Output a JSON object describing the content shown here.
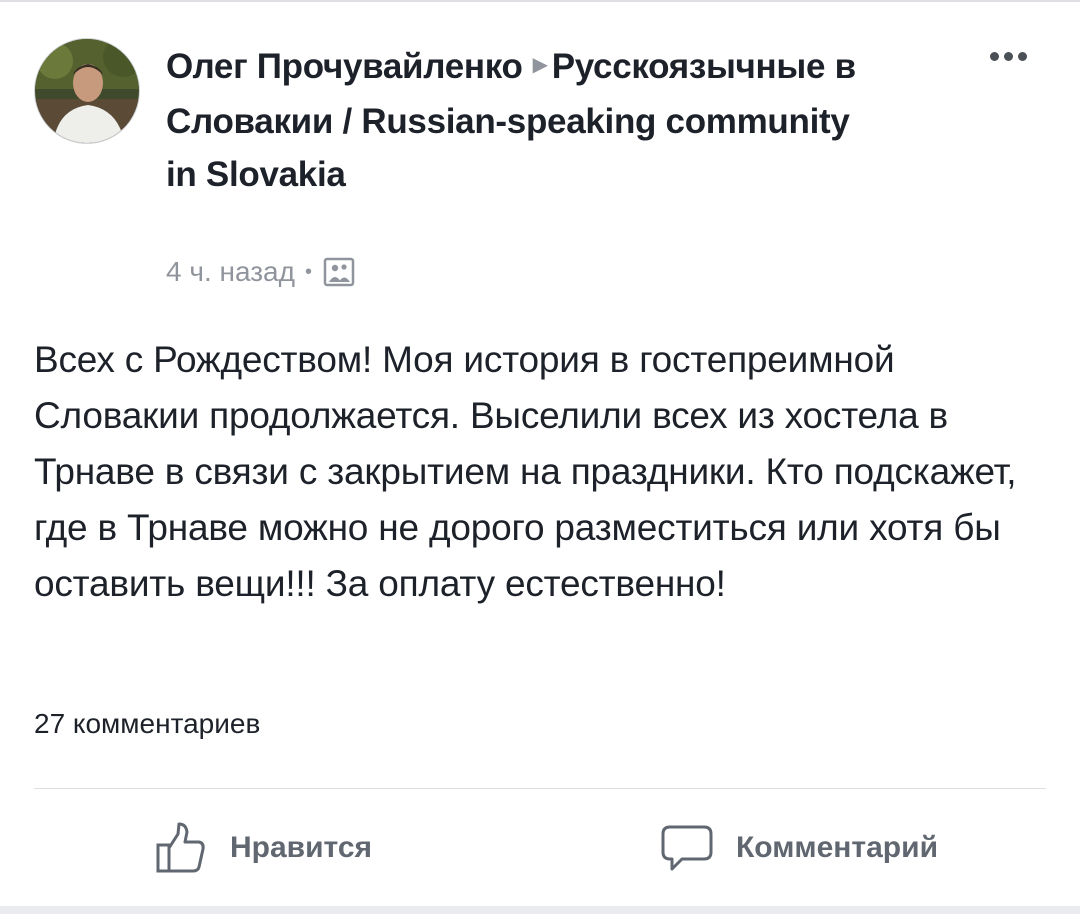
{
  "post": {
    "author": "Олег Прочувайленко",
    "arrow_icon": "triangle-right-icon",
    "group": "Русскоязычные в Словакии / Russian-speaking community in Slovakia",
    "time": "4 ч. назад",
    "separator": "•",
    "audience_icon": "group-photo-icon",
    "more_icon": "three-dots-icon",
    "body": "Всех с Рождеством! Моя история в гостепреимной Словакии продолжается. Выселили всех из хостела в Трнаве в связи с закрытием на праздники. Кто подскажет, где в Трнаве можно не дорого разместиться или хотя бы оставить вещи!!! За оплату естественно!",
    "comments_count": "27 комментариев"
  },
  "actions": {
    "like_label": "Нравится",
    "like_icon": "thumbs-up-icon",
    "comment_label": "Комментарий",
    "comment_icon": "speech-bubble-icon"
  },
  "colors": {
    "text": "#1d2129",
    "secondary": "#90949c",
    "action": "#606770",
    "divider": "#dddfe2"
  }
}
